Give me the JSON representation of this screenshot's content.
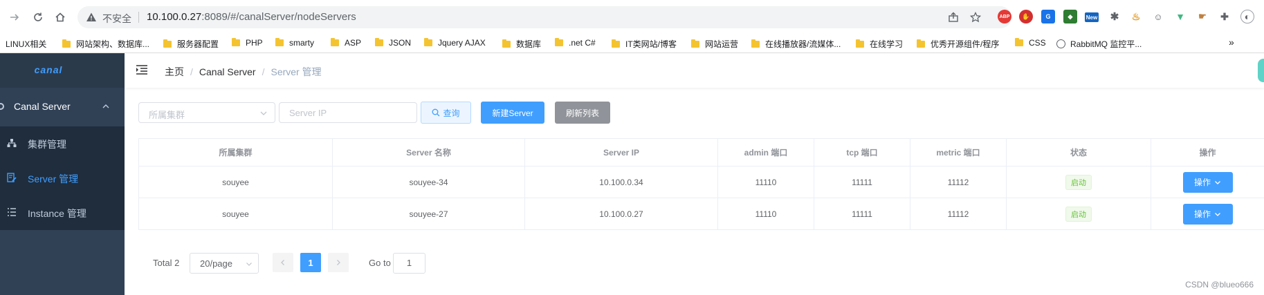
{
  "browser": {
    "insecure_label": "不安全",
    "url_host": "10.100.0.27",
    "url_path": ":8089/#/canalServer/nodeServers",
    "extensions": [
      {
        "name": "abp-icon",
        "text": "ABP",
        "color": "#e53935"
      },
      {
        "name": "stop-icon",
        "text": "✋",
        "color": "#d32f2f"
      },
      {
        "name": "translate-icon",
        "text": "G",
        "color": "#1a73e8"
      },
      {
        "name": "new-icon",
        "text": "New",
        "color": "#1565c0"
      }
    ]
  },
  "bookmarks": [
    {
      "label": "LINUX相关",
      "type": "text"
    },
    {
      "label": "网站架构、数据库...",
      "type": "folder"
    },
    {
      "label": "服务器配置",
      "type": "folder"
    },
    {
      "label": "PHP",
      "type": "folder"
    },
    {
      "label": "smarty",
      "type": "folder"
    },
    {
      "label": "ASP",
      "type": "folder"
    },
    {
      "label": "JSON",
      "type": "folder"
    },
    {
      "label": "Jquery AJAX",
      "type": "folder"
    },
    {
      "label": "数据库",
      "type": "folder"
    },
    {
      "label": ".net C#",
      "type": "folder"
    },
    {
      "label": "IT类网站/博客",
      "type": "folder"
    },
    {
      "label": "网站运营",
      "type": "folder"
    },
    {
      "label": "在线播放器/流媒体...",
      "type": "folder"
    },
    {
      "label": "在线学习",
      "type": "folder"
    },
    {
      "label": "优秀开源组件/程序",
      "type": "folder"
    },
    {
      "label": "CSS",
      "type": "folder"
    },
    {
      "label": "RabbitMQ 监控平...",
      "type": "globe"
    }
  ],
  "more_bookmarks": "»",
  "sidebar": {
    "logo": "canal",
    "parent_label": "Canal Server",
    "items": [
      {
        "label": "集群管理",
        "active": false
      },
      {
        "label": "Server 管理",
        "active": true
      },
      {
        "label": "Instance 管理",
        "active": false
      }
    ]
  },
  "breadcrumb": {
    "home": "主页",
    "section": "Canal Server",
    "current": "Server 管理",
    "separator": "/"
  },
  "filters": {
    "cluster_placeholder": "所属集群",
    "ip_placeholder": "Server IP",
    "query_label": "查询",
    "new_label": "新建Server",
    "refresh_label": "刷新列表"
  },
  "table": {
    "columns": [
      "所属集群",
      "Server 名称",
      "Server IP",
      "admin 端口",
      "tcp 端口",
      "metric 端口",
      "状态",
      "操作"
    ],
    "rows": [
      {
        "cluster": "souyee",
        "name": "souyee-34",
        "ip": "10.100.0.34",
        "admin": "11110",
        "tcp": "11111",
        "metric": "11112",
        "status": "启动",
        "action": "操作"
      },
      {
        "cluster": "souyee",
        "name": "souyee-27",
        "ip": "10.100.0.27",
        "admin": "11110",
        "tcp": "11111",
        "metric": "11112",
        "status": "启动",
        "action": "操作"
      }
    ]
  },
  "pagination": {
    "total": "Total 2",
    "page_size": "20/page",
    "current_page": "1",
    "goto_label": "Go to",
    "goto_value": "1"
  },
  "watermark": "CSDN @blueo666",
  "colors": {
    "primary": "#409eff",
    "sidebar": "#304156",
    "success": "#67c23a"
  }
}
